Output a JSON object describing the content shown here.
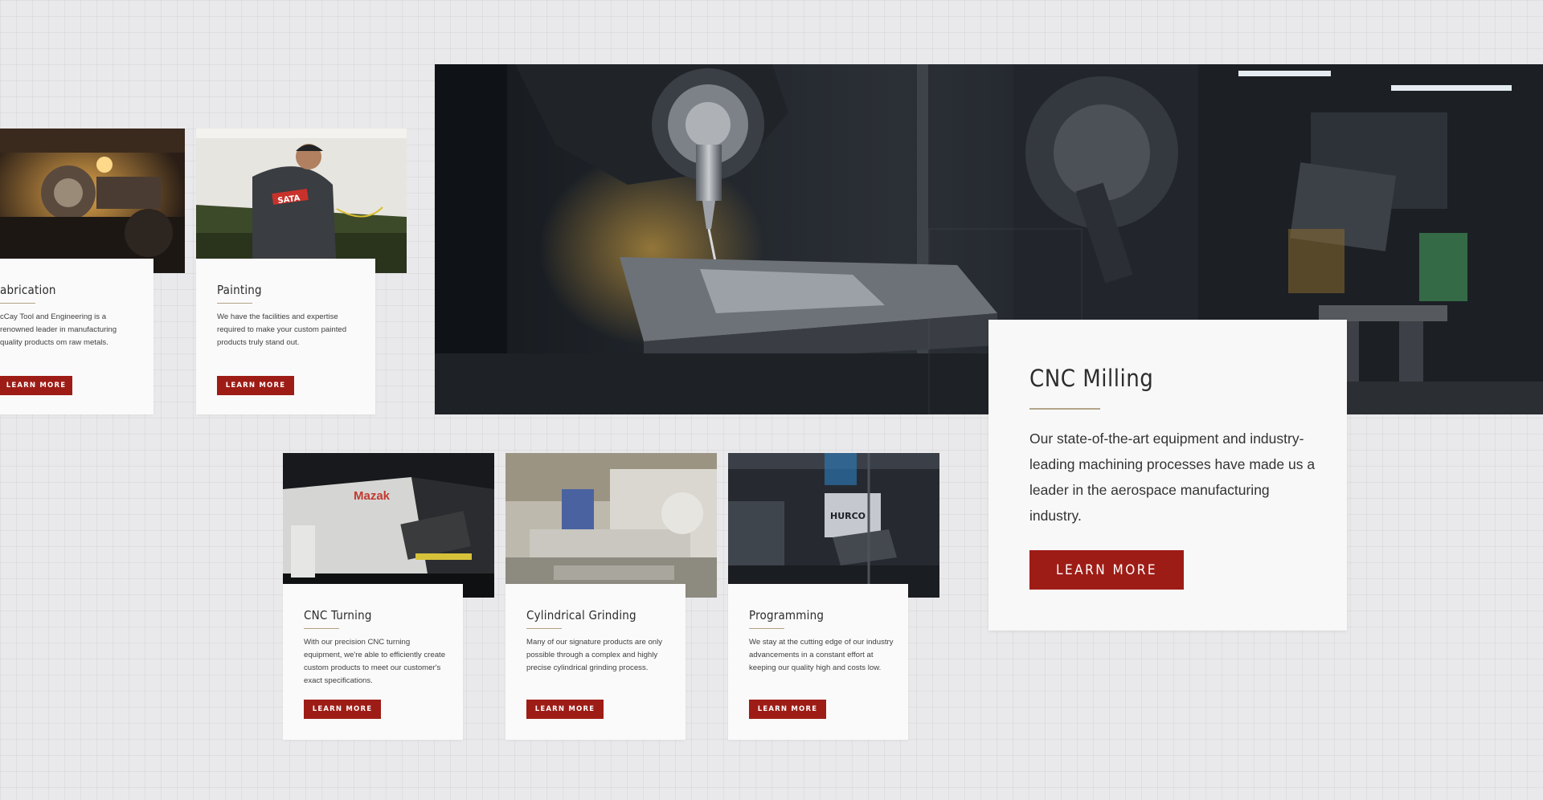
{
  "feature": {
    "title": "CNC Milling",
    "text": "Our state-of-the-art equipment and industry-leading machining processes have made us a leader in the aerospace manufacturing industry.",
    "button": "LEARN MORE"
  },
  "top_cards": [
    {
      "title": "abrication",
      "text": "cCay Tool and Engineering is a renowned leader in manufacturing quality products om raw metals.",
      "button": "LEARN MORE"
    },
    {
      "title": "Painting",
      "text": "We have the facilities and expertise required to make your custom painted products truly stand out.",
      "button": "LEARN MORE"
    }
  ],
  "bottom_cards": [
    {
      "title": "CNC Turning",
      "text": "With our precision CNC turning equipment, we're able to efficiently create custom products to meet our customer's exact specifications.",
      "button": "LEARN MORE"
    },
    {
      "title": "Cylindrical Grinding",
      "text": "Many of our signature products are only possible through a complex and highly precise cylindrical grinding process.",
      "button": "LEARN MORE"
    },
    {
      "title": "Programming",
      "text": "We stay at the cutting edge of our industry advancements in a constant effort at keeping our quality high and costs low.",
      "button": "LEARN MORE"
    }
  ],
  "image_labels": {
    "painting_jacket": "SATA",
    "turning_machine": "Mazak",
    "programming_machine": "HURCO"
  },
  "colors": {
    "accent_red": "#9e1c16",
    "rule_gold": "#b3a48a",
    "background": "#e9e9eb",
    "card": "#fafafa"
  }
}
